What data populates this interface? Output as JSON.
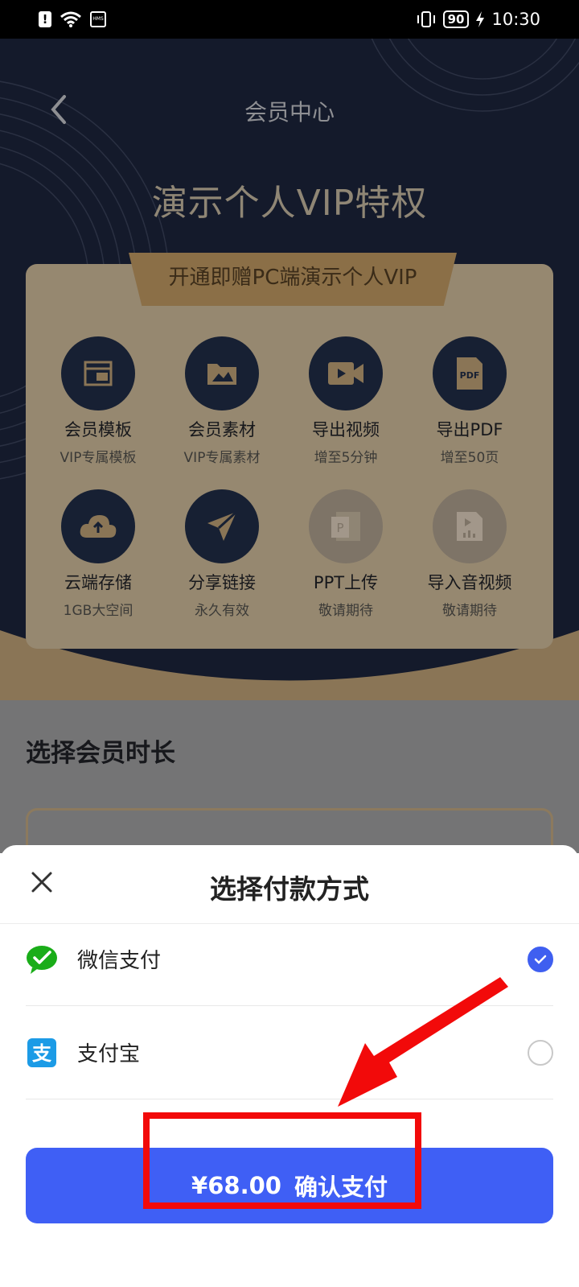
{
  "status_bar": {
    "time": "10:30",
    "battery": "90"
  },
  "header": {
    "title": "会员中心"
  },
  "hero": {
    "title": "演示个人VIP特权",
    "ribbon": "开通即赠PC端演示个人VIP"
  },
  "benefits": [
    {
      "label": "会员模板",
      "sub": "VIP专属模板",
      "icon": "template-icon"
    },
    {
      "label": "会员素材",
      "sub": "VIP专属素材",
      "icon": "image-folder-icon"
    },
    {
      "label": "导出视频",
      "sub": "增至5分钟",
      "icon": "video-icon"
    },
    {
      "label": "导出PDF",
      "sub": "增至50页",
      "icon": "pdf-icon",
      "icon_text": "PDF"
    },
    {
      "label": "云端存储",
      "sub": "1GB大空间",
      "icon": "cloud-upload-icon"
    },
    {
      "label": "分享链接",
      "sub": "永久有效",
      "icon": "send-icon"
    },
    {
      "label": "PPT上传",
      "sub": "敬请期待",
      "icon": "ppt-icon",
      "icon_text": "P"
    },
    {
      "label": "导入音视频",
      "sub": "敬请期待",
      "icon": "media-import-icon"
    }
  ],
  "duration": {
    "title": "选择会员时长"
  },
  "payment_sheet": {
    "title": "选择付款方式",
    "methods": [
      {
        "label": "微信支付",
        "selected": true,
        "icon": "wechat-pay-icon"
      },
      {
        "label": "支付宝",
        "selected": false,
        "icon": "alipay-icon",
        "icon_text": "支"
      }
    ],
    "confirm": {
      "price": "¥68.00",
      "label": "确认支付"
    }
  },
  "colors": {
    "hero_bg": "#141a2b",
    "gold_card": "#968870",
    "primary_button": "#3f5ff5",
    "annotation_red": "#f20a0a"
  }
}
